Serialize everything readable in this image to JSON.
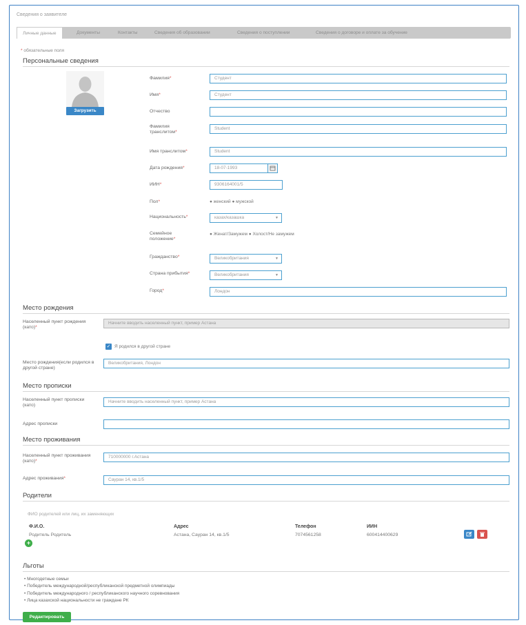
{
  "breadcrumb": "Сведения о заявителе",
  "tabs": [
    {
      "label": "Личные данные"
    },
    {
      "label": "Документы"
    },
    {
      "label": "Контакты"
    },
    {
      "label": "Сведения об образовании"
    },
    {
      "label": "Сведения о поступлении"
    },
    {
      "label": "Сведения о договоре и оплате за обучение"
    }
  ],
  "required_note": "обязательные поля",
  "required_star": "*",
  "personal": {
    "title": "Персональные сведения",
    "upload_label": "Загрузить",
    "surname_label": "Фамилия",
    "surname_value": "Студент",
    "name_label": "Имя",
    "name_value": "Студент",
    "patronymic_label": "Отчество",
    "patronymic_value": "",
    "surname_translit_label": "Фамилия транслитом",
    "surname_translit_value": "Student",
    "name_translit_label": "Имя транслитом",
    "name_translit_value": "Student",
    "birthdate_label": "Дата рождения",
    "birthdate_value": "18-07-1993",
    "iin_label": "ИИН",
    "iin_value": "9306164001/5",
    "gender_label": "Пол",
    "gender_options": "● женский ● мужской",
    "nationality_label": "Национальность",
    "nationality_value": "казах/казашка",
    "marital_label": "Семейное положение",
    "marital_options": "● Женат/Замужем ● Холост/Не замужем",
    "citizenship_label": "Гражданство",
    "citizenship_value": "Великобритания",
    "arrival_country_label": "Страна прибытия",
    "arrival_country_value": "Великобритания",
    "city_label": "Город",
    "city_value": "Лондон"
  },
  "birthplace": {
    "title": "Место рождения",
    "locality_label": "Населенный пункт рождения (като)",
    "locality_placeholder": "Начните вводить населенный пункт, пример Астана",
    "abroad_checkbox_label": "Я родился в другой стране",
    "abroad_place_label": "Место рождения(если родился в другой стране)",
    "abroad_place_value": "Великобритания, Лондон"
  },
  "registration": {
    "title": "Место прописки",
    "locality_label": "Населенный пункт прописки (като)",
    "locality_placeholder": "Начните вводить населенный пункт, пример Астана",
    "address_label": "Адрес прописки",
    "address_value": ""
  },
  "residence": {
    "title": "Место проживания",
    "locality_label": "Населенный пункт проживания (като)",
    "locality_value": "710000000 г.Астана",
    "address_label": "Адрес проживания",
    "address_value": "Сауран 14, кв.1/5"
  },
  "parents": {
    "title": "Родители",
    "hint": "ФИО родителей или лиц, их заменяющих",
    "columns": [
      "Ф.И.О.",
      "Адрес",
      "Телефон",
      "ИИН"
    ],
    "rows": [
      {
        "fio": "Родитель Родитель",
        "address": "Астана, Сауран 14, кв.1/5",
        "phone": "7074561258",
        "iin": "600414400629"
      }
    ]
  },
  "benefits": {
    "title": "Льготы",
    "items": [
      "Многодетные семьи",
      "Победитель международной/республиканской предметной олимпиады",
      "Победитель международного / республиканского научного соревнования",
      "Лица казахской национальности не граждане РК"
    ]
  },
  "edit_button": "Редактировать",
  "colors": {
    "accent": "#3a87c7",
    "required": "#d9534f",
    "success": "#3fae4a",
    "danger": "#d9534f"
  }
}
